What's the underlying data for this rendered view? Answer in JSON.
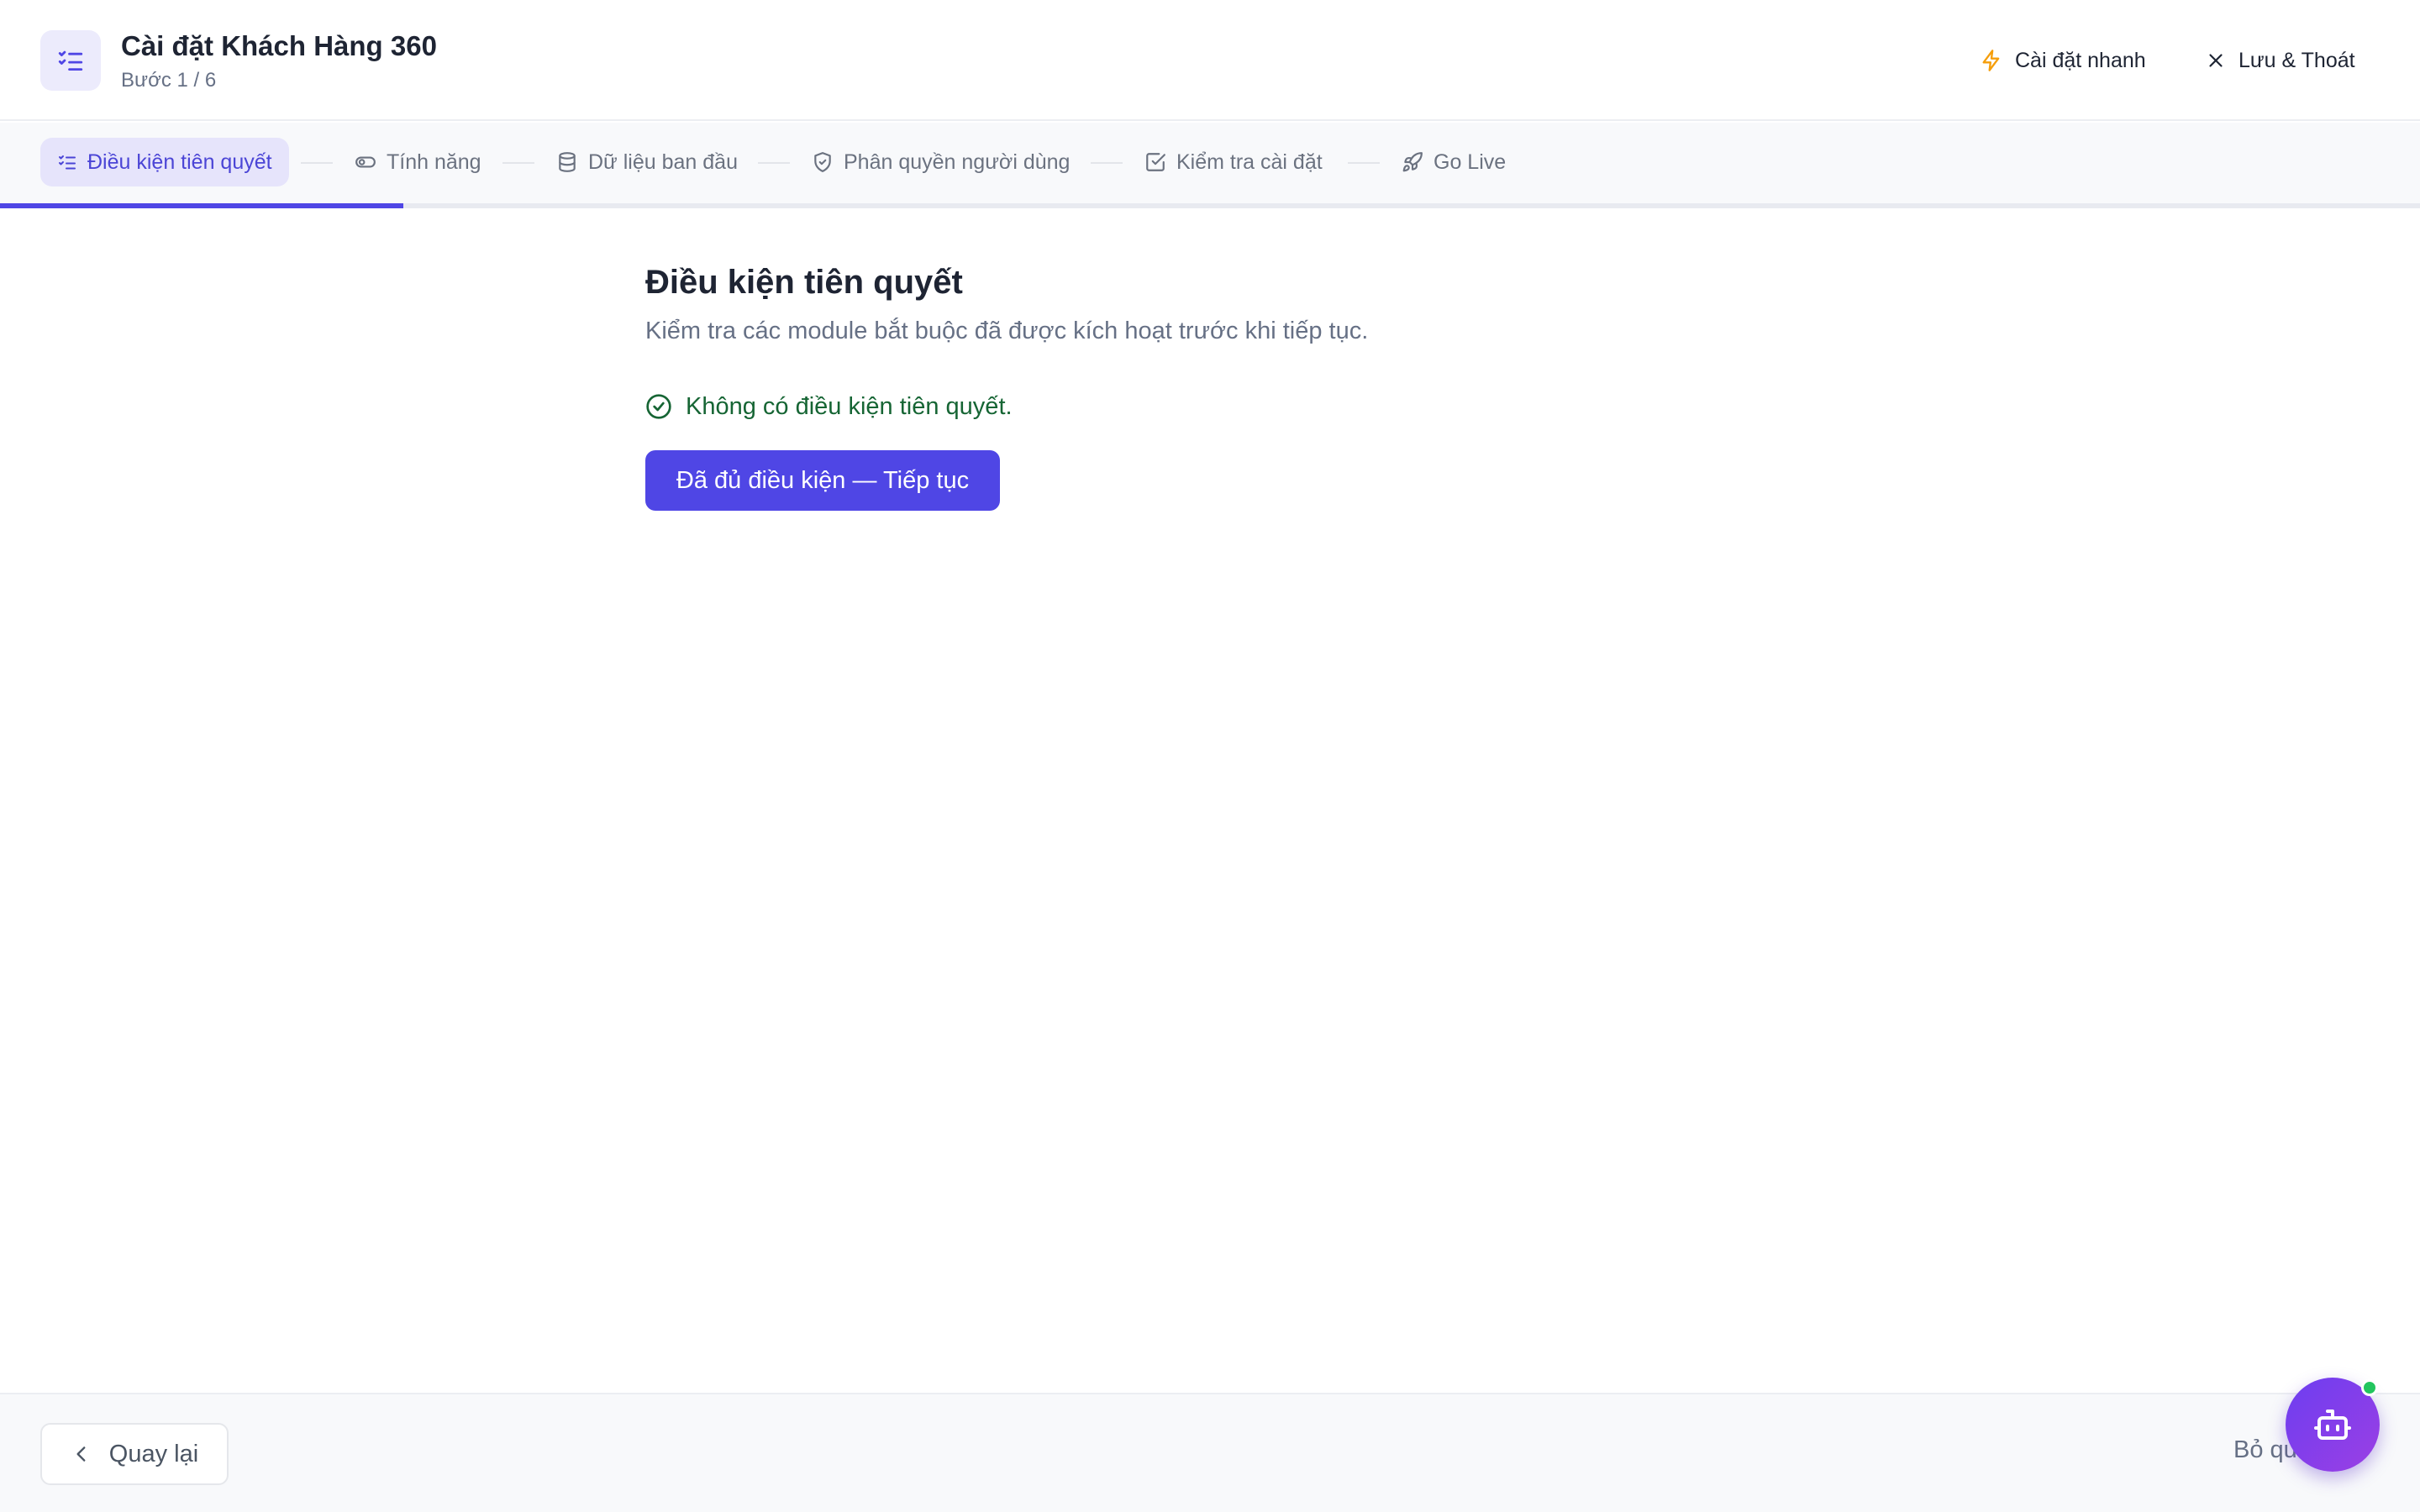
{
  "header": {
    "icon": "list-checks-icon",
    "title": "Cài đặt Khách Hàng 360",
    "step_indicator": "Bước 1 / 6",
    "quick_setup_label": "Cài đặt nhanh",
    "quick_setup_icon": "lightning-icon",
    "save_exit_label": "Lưu & Thoát",
    "save_exit_icon": "close-icon"
  },
  "stepper": {
    "steps": [
      {
        "label": "Điều kiện tiên quyết",
        "icon": "list-checks-icon",
        "active": true
      },
      {
        "label": "Tính năng",
        "icon": "toggle-icon",
        "active": false
      },
      {
        "label": "Dữ liệu ban đầu",
        "icon": "database-icon",
        "active": false
      },
      {
        "label": "Phân quyền người dùng",
        "icon": "shield-icon",
        "active": false
      },
      {
        "label": "Kiểm tra cài đặt",
        "icon": "checkbox-icon",
        "active": false
      },
      {
        "label": "Go Live",
        "icon": "rocket-icon",
        "active": false
      }
    ],
    "progress_fraction": 0.1667
  },
  "main": {
    "title": "Điều kiện tiên quyết",
    "description": "Kiểm tra các module bắt buộc đã được kích hoạt trước khi tiếp tục.",
    "status_text": "Không có điều kiện tiên quyết.",
    "status_icon": "check-circle-icon",
    "continue_label": "Đã đủ điều kiện — Tiếp tục"
  },
  "footer": {
    "back_label": "Quay lại",
    "skip_label": "Bỏ qua"
  },
  "assistant": {
    "icon": "robot-icon",
    "online": true
  },
  "colors": {
    "accent": "#4f46e5",
    "active_step_bg": "#e6e4fb",
    "success": "#166534",
    "quick_setup_icon": "#f59e0b",
    "online_dot": "#22c55e"
  }
}
